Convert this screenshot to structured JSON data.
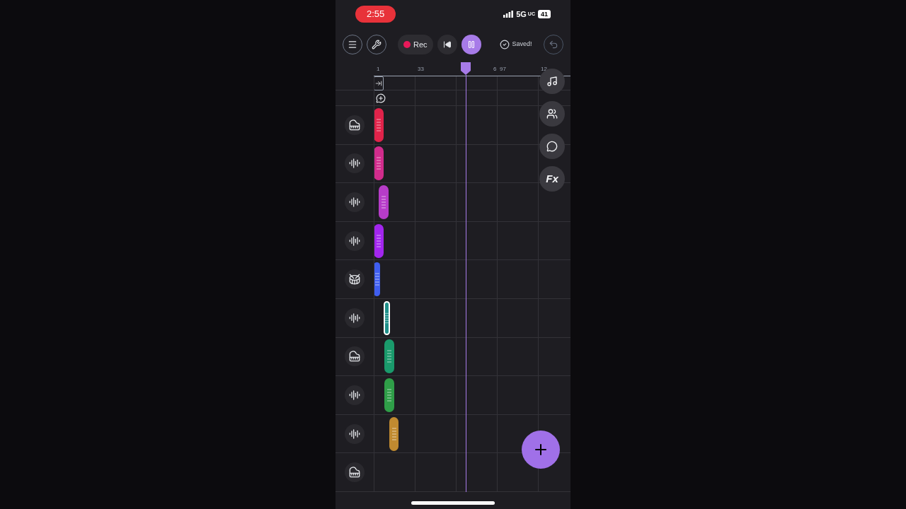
{
  "status_bar": {
    "time": "2:55",
    "network": "5G",
    "network_badge": "UC",
    "battery": "41"
  },
  "toolbar": {
    "record_label": "Rec",
    "playing": true,
    "save_status": "Saved!"
  },
  "ruler": {
    "ticks": [
      "1",
      "33",
      "6",
      "97",
      "12"
    ]
  },
  "right_tools": [
    {
      "kind": "music"
    },
    {
      "kind": "users"
    },
    {
      "kind": "comment"
    },
    {
      "kind": "fx",
      "label": "Fx"
    }
  ],
  "tracks": [
    {
      "kind": "piano",
      "clip": {
        "color": "#e0234a",
        "selected": false
      }
    },
    {
      "kind": "audio",
      "clip": {
        "color": "#d12c8c",
        "selected": false
      }
    },
    {
      "kind": "audio",
      "clip": {
        "color": "#b63cc8",
        "selected": false
      }
    },
    {
      "kind": "audio",
      "clip": {
        "color": "#a226ee",
        "selected": false
      }
    },
    {
      "kind": "drum",
      "clip": {
        "color": "#3f5ef0",
        "selected": false
      }
    },
    {
      "kind": "audio",
      "clip": {
        "color": "#1f8f8a",
        "selected": true
      }
    },
    {
      "kind": "piano",
      "clip": {
        "color": "#1a9a6c",
        "selected": false
      }
    },
    {
      "kind": "audio",
      "clip": {
        "color": "#2f9e48",
        "selected": false
      }
    },
    {
      "kind": "audio",
      "clip": {
        "color": "#c08a30",
        "selected": false
      }
    },
    {
      "kind": "piano"
    }
  ]
}
